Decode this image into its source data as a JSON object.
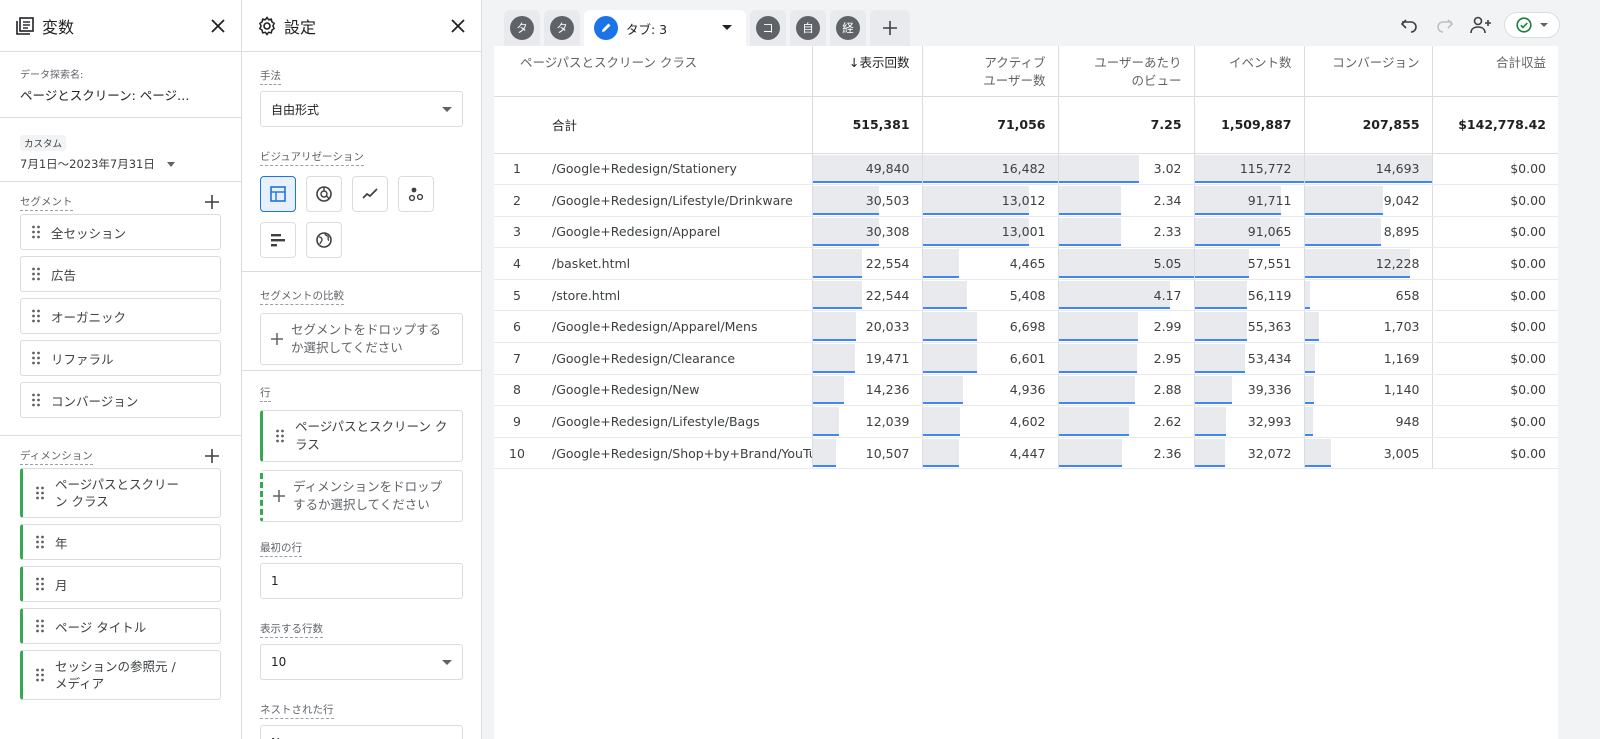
{
  "variables": {
    "title": "変数",
    "explore_name_label": "データ探索名:",
    "explore_name_value": "ページとスクリーン: ページ…",
    "date_chip": "カスタム",
    "date_range": "7月1日～2023年7月31日",
    "segments_title": "セグメント",
    "segments": [
      "全セッション",
      "広告",
      "オーガニック",
      "リファラル",
      "コンバージョン"
    ],
    "dimensions_title": "ディメンション",
    "dimensions": [
      "ページパスとスクリーン クラス",
      "年",
      "月",
      "ページ タイトル",
      "セッションの参照元 / メディア"
    ]
  },
  "settings": {
    "title": "設定",
    "technique_label": "手法",
    "technique_value": "自由形式",
    "viz_label": "ビジュアリゼーション",
    "viz_buttons": [
      "table-icon",
      "donut-icon",
      "line-chart-icon",
      "scatter-icon",
      "bar-chart-icon",
      "globe-icon"
    ],
    "segment_compare_label": "セグメントの比較",
    "segment_drop": "セグメントをドロップするか選択してください",
    "rows_label": "行",
    "row_item": "ページパスとスクリーン クラス",
    "dimension_drop": "ディメンションをドロップするか選択してください",
    "first_row_label": "最初の行",
    "first_row_value": "1",
    "rows_shown_label": "表示する行数",
    "rows_shown_value": "10",
    "nested_label": "ネストされた行",
    "nested_value": "No"
  },
  "tabs": {
    "items": [
      "タ",
      "タ",
      "タブ: 3",
      "コ",
      "自",
      "経"
    ],
    "active_index": 2
  },
  "colors": {
    "accent": "#1a73e8",
    "bar": "#e8eaed",
    "bar_line": "#4285f4",
    "green": "#34a853"
  },
  "table": {
    "headers": [
      "ページパスとスクリーン クラス",
      "↓表示回数",
      "アクティブ ユーザー数",
      "ユーザーあたり のビュー",
      "イベント数",
      "コンバージョン",
      "合計収益"
    ],
    "header_lines": {
      "m2": [
        "アクティブ",
        "ユーザー数"
      ],
      "m3": [
        "ユーザーあたり",
        "のビュー"
      ]
    },
    "total": {
      "label": "合計",
      "values": [
        "515,381",
        "71,056",
        "7.25",
        "1,509,887",
        "207,855",
        "$142,778.42"
      ]
    },
    "rows": [
      {
        "idx": "1",
        "path": "/Google+Redesign/Stationery",
        "values": [
          "49,840",
          "16,482",
          "3.02",
          "115,772",
          "14,693",
          "$0.00"
        ]
      },
      {
        "idx": "2",
        "path": "/Google+Redesign/Lifestyle/Drinkware",
        "values": [
          "30,503",
          "13,012",
          "2.34",
          "91,711",
          "9,042",
          "$0.00"
        ]
      },
      {
        "idx": "3",
        "path": "/Google+Redesign/Apparel",
        "values": [
          "30,308",
          "13,001",
          "2.33",
          "91,065",
          "8,895",
          "$0.00"
        ]
      },
      {
        "idx": "4",
        "path": "/basket.html",
        "values": [
          "22,554",
          "4,465",
          "5.05",
          "57,551",
          "12,228",
          "$0.00"
        ]
      },
      {
        "idx": "5",
        "path": "/store.html",
        "values": [
          "22,544",
          "5,408",
          "4.17",
          "56,119",
          "658",
          "$0.00"
        ]
      },
      {
        "idx": "6",
        "path": "/Google+Redesign/Apparel/Mens",
        "values": [
          "20,033",
          "6,698",
          "2.99",
          "55,363",
          "1,703",
          "$0.00"
        ]
      },
      {
        "idx": "7",
        "path": "/Google+Redesign/Clearance",
        "values": [
          "19,471",
          "6,601",
          "2.95",
          "53,434",
          "1,169",
          "$0.00"
        ]
      },
      {
        "idx": "8",
        "path": "/Google+Redesign/New",
        "values": [
          "14,236",
          "4,936",
          "2.88",
          "39,336",
          "1,140",
          "$0.00"
        ]
      },
      {
        "idx": "9",
        "path": "/Google+Redesign/Lifestyle/Bags",
        "values": [
          "12,039",
          "4,602",
          "2.62",
          "32,993",
          "948",
          "$0.00"
        ]
      },
      {
        "idx": "10",
        "path": "/Google+Redesign/Shop+by+Brand/YouTube",
        "values": [
          "10,507",
          "4,447",
          "2.36",
          "32,072",
          "3,005",
          "$0.00"
        ]
      }
    ]
  }
}
